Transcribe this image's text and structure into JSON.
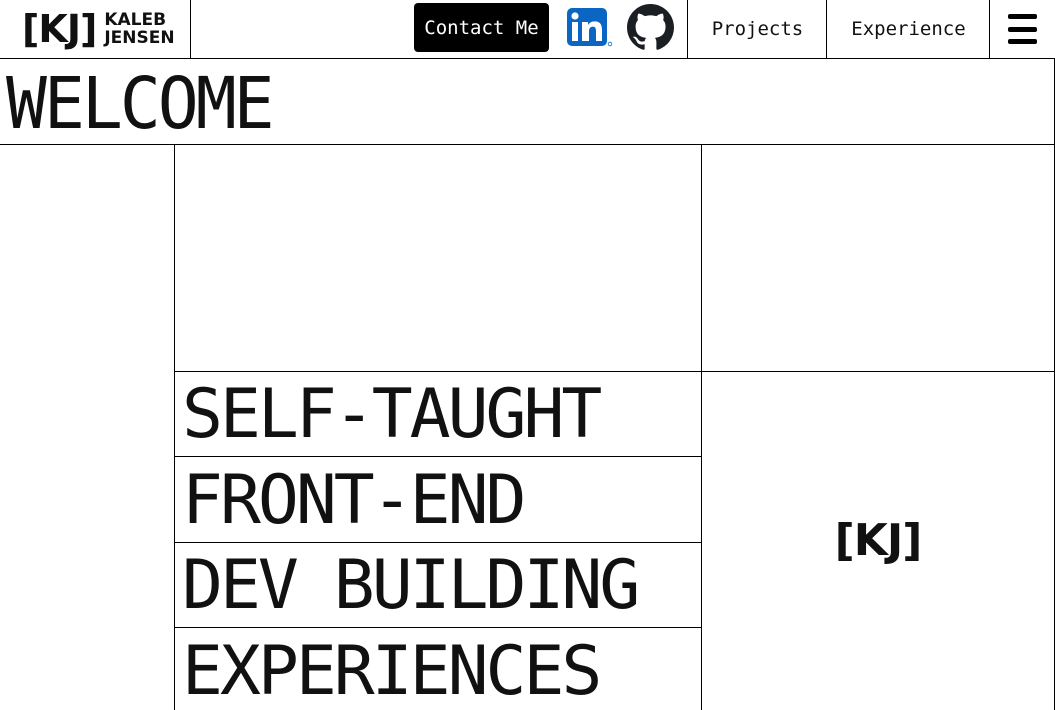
{
  "header": {
    "logo_mark": "[KJ]",
    "logo_name_first": "KALEB",
    "logo_name_last": "JENSEN",
    "contact_label": "Contact Me",
    "nav": [
      {
        "label": "Projects"
      },
      {
        "label": "Experience"
      }
    ],
    "icons": {
      "linkedin": "linkedin-icon",
      "github": "github-icon",
      "menu": "hamburger-menu-icon"
    }
  },
  "hero": {
    "title": "WELCOME",
    "tagline": [
      "SELF-TAUGHT",
      "FRONT-END",
      "DEV BUILDING",
      "EXPERIENCES"
    ],
    "mini_mark": "[KJ]"
  },
  "colors": {
    "text": "#111111",
    "background": "#ffffff",
    "button_bg": "#000000",
    "linkedin_blue": "#0a66c2"
  }
}
